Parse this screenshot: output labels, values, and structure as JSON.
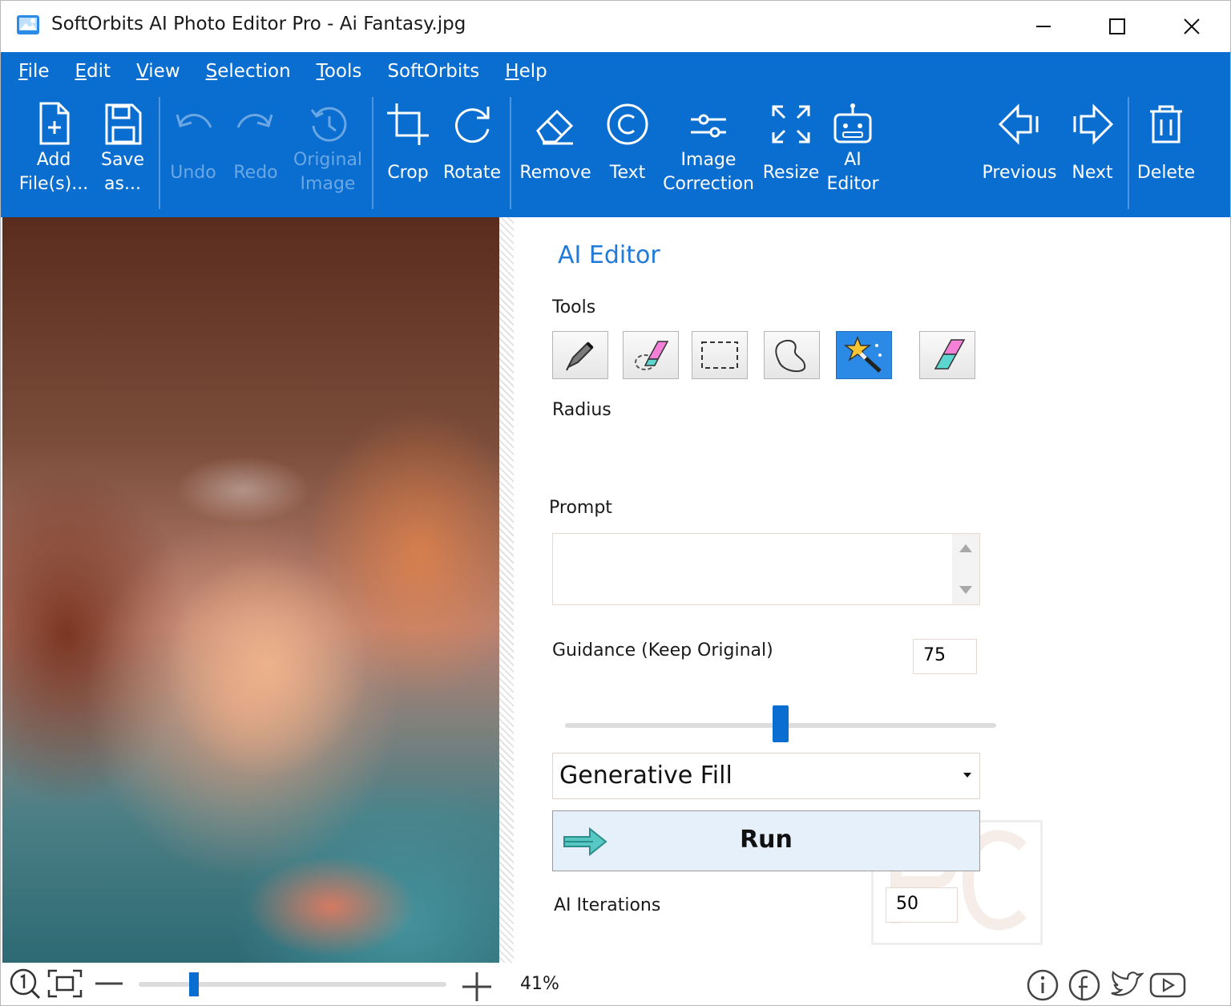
{
  "window": {
    "title": "SoftOrbits AI Photo Editor Pro - Ai Fantasy.jpg",
    "icons": [
      "app-icon",
      "minimize-icon",
      "maximize-icon",
      "close-icon"
    ]
  },
  "menu": [
    {
      "pre": "",
      "u": "F",
      "post": "ile"
    },
    {
      "pre": "",
      "u": "E",
      "post": "dit"
    },
    {
      "pre": "",
      "u": "V",
      "post": "iew"
    },
    {
      "pre": "",
      "u": "S",
      "post": "election"
    },
    {
      "pre": "",
      "u": "T",
      "post": "ools"
    },
    {
      "pre": "SoftOrbits",
      "u": "",
      "post": ""
    },
    {
      "pre": "",
      "u": "H",
      "post": "elp"
    }
  ],
  "toolbar": {
    "add_files": [
      "Add",
      "File(s)..."
    ],
    "save_as": [
      "Save",
      "as..."
    ],
    "undo": "Undo",
    "redo": "Redo",
    "original_image": [
      "Original",
      "Image"
    ],
    "crop": "Crop",
    "rotate": "Rotate",
    "remove": "Remove",
    "text": "Text",
    "image_correction": [
      "Image",
      "Correction"
    ],
    "resize": "Resize",
    "ai_editor": [
      "AI",
      "Editor"
    ],
    "previous": "Previous",
    "next": "Next",
    "delete": "Delete"
  },
  "panel": {
    "title": "AI Editor",
    "tools_label": "Tools",
    "radius_label": "Radius",
    "prompt_label": "Prompt",
    "prompt_value": "",
    "guidance_label": "Guidance (Keep Original)",
    "guidance_value": "75",
    "guidance_slider_fraction": 0.5,
    "mode": "Generative Fill",
    "run_label": "Run",
    "iterations_label": "AI Iterations",
    "iterations_value": "50",
    "active_tool": "magic-wand"
  },
  "status": {
    "zoom_text": "41%",
    "zoom_slider_fraction": 0.18,
    "icons": [
      "zoom-actual-icon",
      "fit-screen-icon",
      "zoom-out-icon",
      "zoom-in-icon",
      "info-icon",
      "facebook-icon",
      "twitter-icon",
      "youtube-icon"
    ]
  },
  "colors": {
    "ribbon": "#0a6ed1",
    "accent": "#1f7ad8"
  }
}
